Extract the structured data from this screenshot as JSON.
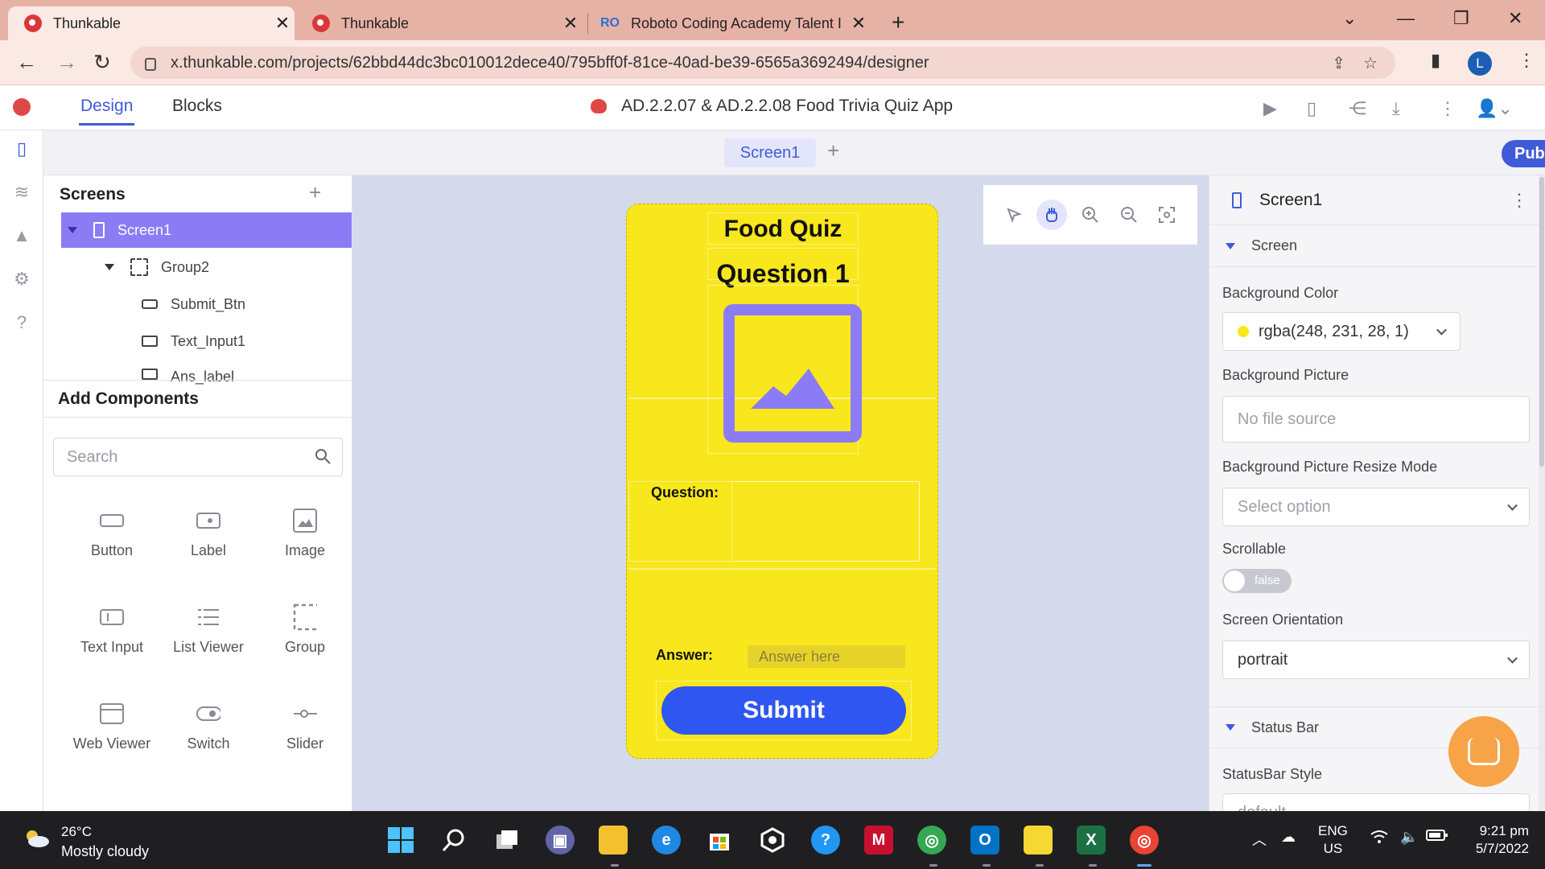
{
  "browser": {
    "tabs": [
      {
        "title": "Thunkable",
        "active": true
      },
      {
        "title": "Thunkable",
        "active": false
      },
      {
        "title": "Roboto Coding Academy Talent I",
        "favicon_text": "RO",
        "active": false
      }
    ],
    "url": "x.thunkable.com/projects/62bbd44dc3bc010012dece40/795bff0f-81ce-40ad-be39-6565a3692494/designer",
    "profile_initial": "L"
  },
  "app": {
    "tabs": {
      "design": "Design",
      "blocks": "Blocks"
    },
    "project_title": "AD.2.2.07 & AD.2.2.08 Food Trivia Quiz App",
    "screen_tab": "Screen1",
    "public_label": "Public",
    "accent_color": "#3f5bd9"
  },
  "screens_panel": {
    "title": "Screens",
    "tree": [
      {
        "label": "Screen1",
        "selected": true
      },
      {
        "label": "Group2"
      },
      {
        "label": "Submit_Btn"
      },
      {
        "label": "Text_Input1"
      },
      {
        "label": "Ans_label"
      }
    ]
  },
  "components_panel": {
    "title": "Add Components",
    "search_placeholder": "Search",
    "items": [
      {
        "label": "Button",
        "icon": "button-icon"
      },
      {
        "label": "Label",
        "icon": "label-icon"
      },
      {
        "label": "Image",
        "icon": "image-icon"
      },
      {
        "label": "Text Input",
        "icon": "text-input-icon"
      },
      {
        "label": "List Viewer",
        "icon": "list-icon"
      },
      {
        "label": "Group",
        "icon": "group-icon"
      },
      {
        "label": "Web Viewer",
        "icon": "web-viewer-icon"
      },
      {
        "label": "Switch",
        "icon": "switch-icon"
      },
      {
        "label": "Slider",
        "icon": "slider-icon"
      }
    ]
  },
  "phone": {
    "background_color": "#f8e71c",
    "title": "Food Quiz",
    "question_heading": "Question 1",
    "question_label": "Question:",
    "answer_label": "Answer:",
    "answer_placeholder": "Answer here",
    "submit_label": "Submit"
  },
  "properties": {
    "component_name": "Screen1",
    "section_screen": "Screen",
    "bg_color_label": "Background Color",
    "bg_color_value": "rgba(248, 231, 28, 1)",
    "bg_picture_label": "Background Picture",
    "bg_picture_placeholder": "No file source",
    "resize_label": "Background Picture Resize Mode",
    "resize_placeholder": "Select option",
    "scrollable_label": "Scrollable",
    "scrollable_value": "false",
    "orientation_label": "Screen Orientation",
    "orientation_value": "portrait",
    "section_statusbar": "Status Bar",
    "statusbar_style_label": "StatusBar Style",
    "statusbar_style_value": "default"
  },
  "taskbar": {
    "temperature": "26°C",
    "weather": "Mostly cloudy",
    "lang_top": "ENG",
    "lang_bottom": "US",
    "time": "9:21 pm",
    "date": "5/7/2022"
  }
}
